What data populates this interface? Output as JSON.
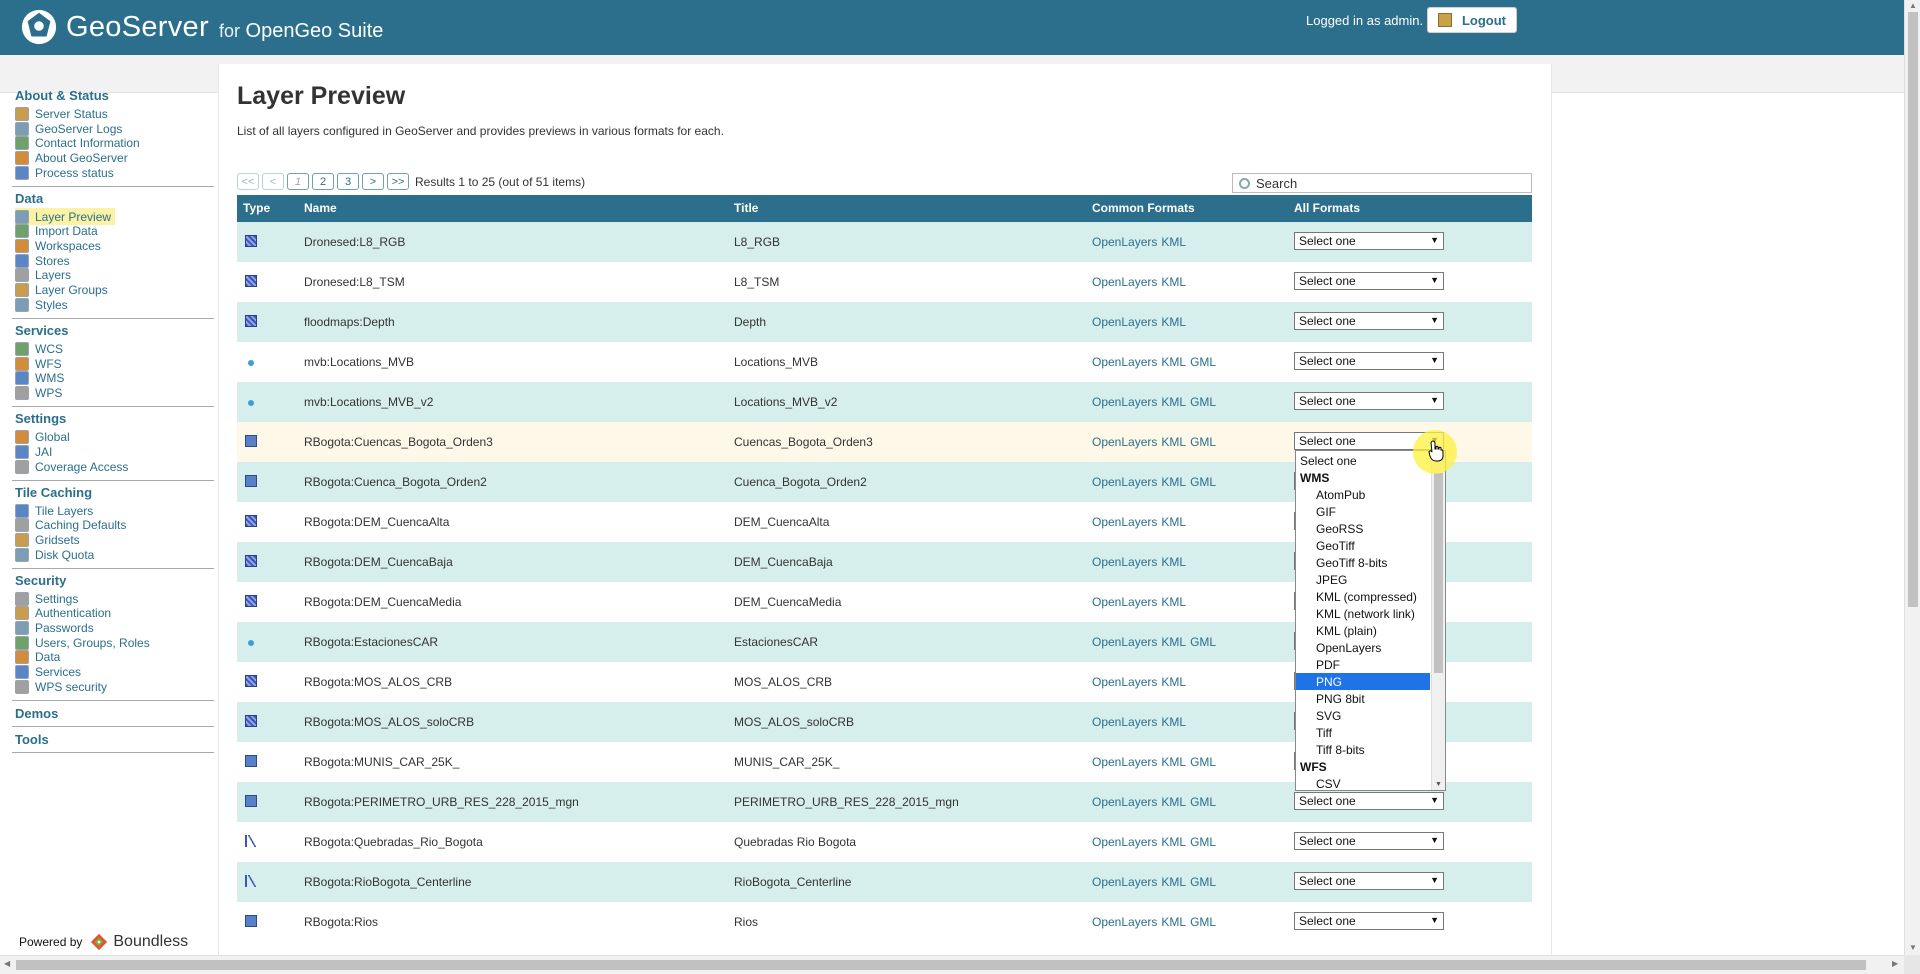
{
  "header": {
    "logo_text": "GeoServer",
    "logo_for": "for",
    "logo_suite": "OpenGeo Suite",
    "login_info": "Logged in as admin.",
    "logout_label": "Logout"
  },
  "sidebar": {
    "sections": [
      {
        "title": "About & Status",
        "items": [
          "Server Status",
          "GeoServer Logs",
          "Contact Information",
          "About GeoServer",
          "Process status"
        ]
      },
      {
        "title": "Data",
        "items": [
          "Layer Preview",
          "Import Data",
          "Workspaces",
          "Stores",
          "Layers",
          "Layer Groups",
          "Styles"
        ]
      },
      {
        "title": "Services",
        "items": [
          "WCS",
          "WFS",
          "WMS",
          "WPS"
        ]
      },
      {
        "title": "Settings",
        "items": [
          "Global",
          "JAI",
          "Coverage Access"
        ]
      },
      {
        "title": "Tile Caching",
        "items": [
          "Tile Layers",
          "Caching Defaults",
          "Gridsets",
          "Disk Quota"
        ]
      },
      {
        "title": "Security",
        "items": [
          "Settings",
          "Authentication",
          "Passwords",
          "Users, Groups, Roles",
          "Data",
          "Services",
          "WPS security"
        ]
      },
      {
        "title": "Demos",
        "items": []
      },
      {
        "title": "Tools",
        "items": []
      }
    ],
    "active_item": "Layer Preview",
    "powered_by": "Powered by",
    "powered_brand": "Boundless"
  },
  "page": {
    "title": "Layer Preview",
    "description": "List of all layers configured in GeoServer and provides previews in various formats for each."
  },
  "pager": {
    "first": "<<",
    "prev": "<",
    "pages": [
      "1",
      "2",
      "3"
    ],
    "next": ">",
    "last": ">>",
    "results": "Results 1 to 25 (out of 51 items)"
  },
  "search": {
    "placeholder": "Search"
  },
  "table": {
    "columns": [
      "Type",
      "Name",
      "Title",
      "Common Formats",
      "All Formats"
    ],
    "rows": [
      {
        "type": "raster",
        "name": "Dronesed:L8_RGB",
        "title": "L8_RGB",
        "formats": [
          "OpenLayers",
          "KML"
        ],
        "select": "Select one"
      },
      {
        "type": "raster",
        "name": "Dronesed:L8_TSM",
        "title": "L8_TSM",
        "formats": [
          "OpenLayers",
          "KML"
        ],
        "select": "Select one"
      },
      {
        "type": "raster",
        "name": "floodmaps:Depth",
        "title": "Depth",
        "formats": [
          "OpenLayers",
          "KML"
        ],
        "select": "Select one"
      },
      {
        "type": "point",
        "name": "mvb:Locations_MVB",
        "title": "Locations_MVB",
        "formats": [
          "OpenLayers",
          "KML",
          "GML"
        ],
        "select": "Select one"
      },
      {
        "type": "point",
        "name": "mvb:Locations_MVB_v2",
        "title": "Locations_MVB_v2",
        "formats": [
          "OpenLayers",
          "KML",
          "GML"
        ],
        "select": "Select one"
      },
      {
        "type": "poly",
        "name": "RBogota:Cuencas_Bogota_Orden3",
        "title": "Cuencas_Bogota_Orden3",
        "formats": [
          "OpenLayers",
          "KML",
          "GML"
        ],
        "select": "Select one"
      },
      {
        "type": "poly",
        "name": "RBogota:Cuenca_Bogota_Orden2",
        "title": "Cuenca_Bogota_Orden2",
        "formats": [
          "OpenLayers",
          "KML",
          "GML"
        ],
        "select": "Select one"
      },
      {
        "type": "raster",
        "name": "RBogota:DEM_CuencaAlta",
        "title": "DEM_CuencaAlta",
        "formats": [
          "OpenLayers",
          "KML"
        ],
        "select": "Select one"
      },
      {
        "type": "raster",
        "name": "RBogota:DEM_CuencaBaja",
        "title": "DEM_CuencaBaja",
        "formats": [
          "OpenLayers",
          "KML"
        ],
        "select": "Select one"
      },
      {
        "type": "raster",
        "name": "RBogota:DEM_CuencaMedia",
        "title": "DEM_CuencaMedia",
        "formats": [
          "OpenLayers",
          "KML"
        ],
        "select": "Select one"
      },
      {
        "type": "point",
        "name": "RBogota:EstacionesCAR",
        "title": "EstacionesCAR",
        "formats": [
          "OpenLayers",
          "KML",
          "GML"
        ],
        "select": "Select one"
      },
      {
        "type": "raster",
        "name": "RBogota:MOS_ALOS_CRB",
        "title": "MOS_ALOS_CRB",
        "formats": [
          "OpenLayers",
          "KML"
        ],
        "select": "Select one"
      },
      {
        "type": "raster",
        "name": "RBogota:MOS_ALOS_soloCRB",
        "title": "MOS_ALOS_soloCRB",
        "formats": [
          "OpenLayers",
          "KML"
        ],
        "select": "Select one"
      },
      {
        "type": "poly",
        "name": "RBogota:MUNIS_CAR_25K_",
        "title": "MUNIS_CAR_25K_",
        "formats": [
          "OpenLayers",
          "KML",
          "GML"
        ],
        "select": "Select one"
      },
      {
        "type": "poly",
        "name": "RBogota:PERIMETRO_URB_RES_228_2015_mgn",
        "title": "PERIMETRO_URB_RES_228_2015_mgn",
        "formats": [
          "OpenLayers",
          "KML",
          "GML"
        ],
        "select": "Select one"
      },
      {
        "type": "line",
        "name": "RBogota:Quebradas_Rio_Bogota",
        "title": "Quebradas Rio Bogota",
        "formats": [
          "OpenLayers",
          "KML",
          "GML"
        ],
        "select": "Select one"
      },
      {
        "type": "line",
        "name": "RBogota:RioBogota_Centerline",
        "title": "RioBogota_Centerline",
        "formats": [
          "OpenLayers",
          "KML",
          "GML"
        ],
        "select": "Select one"
      },
      {
        "type": "poly",
        "name": "RBogota:Rios",
        "title": "Rios",
        "formats": [
          "OpenLayers",
          "KML",
          "GML"
        ],
        "select": "Select one"
      }
    ]
  },
  "dropdown": {
    "items": [
      {
        "kind": "top",
        "label": "Select one"
      },
      {
        "kind": "grp",
        "label": "WMS"
      },
      {
        "kind": "sub",
        "label": "AtomPub"
      },
      {
        "kind": "sub",
        "label": "GIF"
      },
      {
        "kind": "sub",
        "label": "GeoRSS"
      },
      {
        "kind": "sub",
        "label": "GeoTiff"
      },
      {
        "kind": "sub",
        "label": "GeoTiff 8-bits"
      },
      {
        "kind": "sub",
        "label": "JPEG"
      },
      {
        "kind": "sub",
        "label": "KML (compressed)"
      },
      {
        "kind": "sub",
        "label": "KML (network link)"
      },
      {
        "kind": "sub",
        "label": "KML (plain)"
      },
      {
        "kind": "sub",
        "label": "OpenLayers"
      },
      {
        "kind": "sub",
        "label": "PDF"
      },
      {
        "kind": "sub",
        "label": "PNG",
        "selected": true
      },
      {
        "kind": "sub",
        "label": "PNG 8bit"
      },
      {
        "kind": "sub",
        "label": "SVG"
      },
      {
        "kind": "sub",
        "label": "Tiff"
      },
      {
        "kind": "sub",
        "label": "Tiff 8-bits"
      },
      {
        "kind": "grp",
        "label": "WFS"
      },
      {
        "kind": "sub",
        "label": "CSV"
      }
    ]
  },
  "colors": {
    "header": "#2b6f8c",
    "row_alt": "#d6efec",
    "selected": "#1e73e8"
  }
}
